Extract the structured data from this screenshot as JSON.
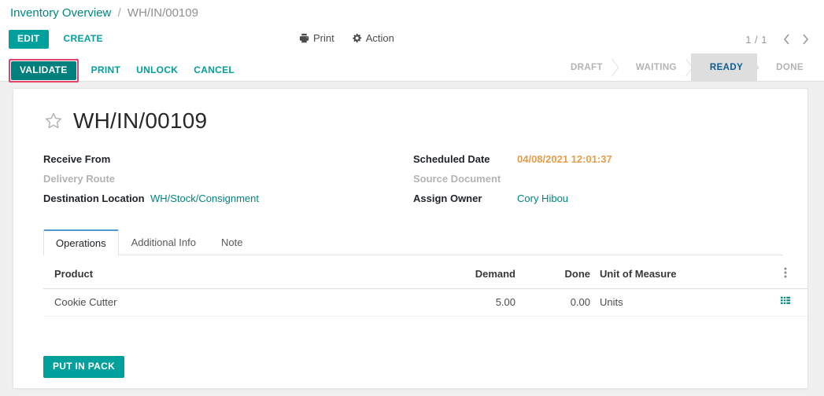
{
  "breadcrumb": {
    "root": "Inventory Overview",
    "separator": "/",
    "current": "WH/IN/00109"
  },
  "control_panel": {
    "edit_label": "EDIT",
    "create_label": "CREATE",
    "print_label": "Print",
    "action_label": "Action",
    "printer_icon": "printer-icon",
    "gear_icon": "gear-icon",
    "pager": {
      "count": "1 / 1",
      "prev_icon": "chevron-left-icon",
      "next_icon": "chevron-right-icon"
    }
  },
  "status_bar": {
    "validate_label": "VALIDATE",
    "print_label": "PRINT",
    "unlock_label": "UNLOCK",
    "cancel_label": "CANCEL",
    "highlight_color": "#e8406a",
    "steps": [
      {
        "label": "DRAFT",
        "active": false
      },
      {
        "label": "WAITING",
        "active": false
      },
      {
        "label": "READY",
        "active": true
      },
      {
        "label": "DONE",
        "active": false
      }
    ],
    "active_step_color": "#0b5c8f"
  },
  "record": {
    "star_icon": "star-outline-icon",
    "title": "WH/IN/00109",
    "fields_left": [
      {
        "label": "Receive From",
        "value": "",
        "style": "plain"
      },
      {
        "label": "Delivery Route",
        "value": "",
        "style": "muted"
      },
      {
        "label": "Destination Location",
        "value": "WH/Stock/Consignment",
        "style": "link"
      }
    ],
    "fields_right": [
      {
        "label": "Scheduled Date",
        "value": "04/08/2021 12:01:37",
        "style": "date"
      },
      {
        "label": "Source Document",
        "value": "",
        "style": "muted"
      },
      {
        "label": "Assign Owner",
        "value": "Cory Hibou",
        "style": "link"
      }
    ]
  },
  "notebook": {
    "tabs": [
      {
        "label": "Operations",
        "active": true
      },
      {
        "label": "Additional Info",
        "active": false
      },
      {
        "label": "Note",
        "active": false
      }
    ]
  },
  "lines_table": {
    "columns": [
      "Product",
      "Demand",
      "Done",
      "Unit of Measure"
    ],
    "optional_columns_icon": "vertical-dots-icon",
    "rows": [
      {
        "product": "Cookie Cutter",
        "demand": "5.00",
        "done": "0.00",
        "uom": "Units",
        "detail_icon": "list-detail-icon"
      }
    ]
  },
  "footer": {
    "put_in_pack_label": "PUT IN PACK"
  },
  "colors": {
    "accent_teal": "#00a09d",
    "validate_teal": "#00807c",
    "link_teal": "#00857f",
    "date_orange": "#e59d4b",
    "highlight_pink": "#e8406a",
    "active_step_blue": "#0b5c8f"
  }
}
